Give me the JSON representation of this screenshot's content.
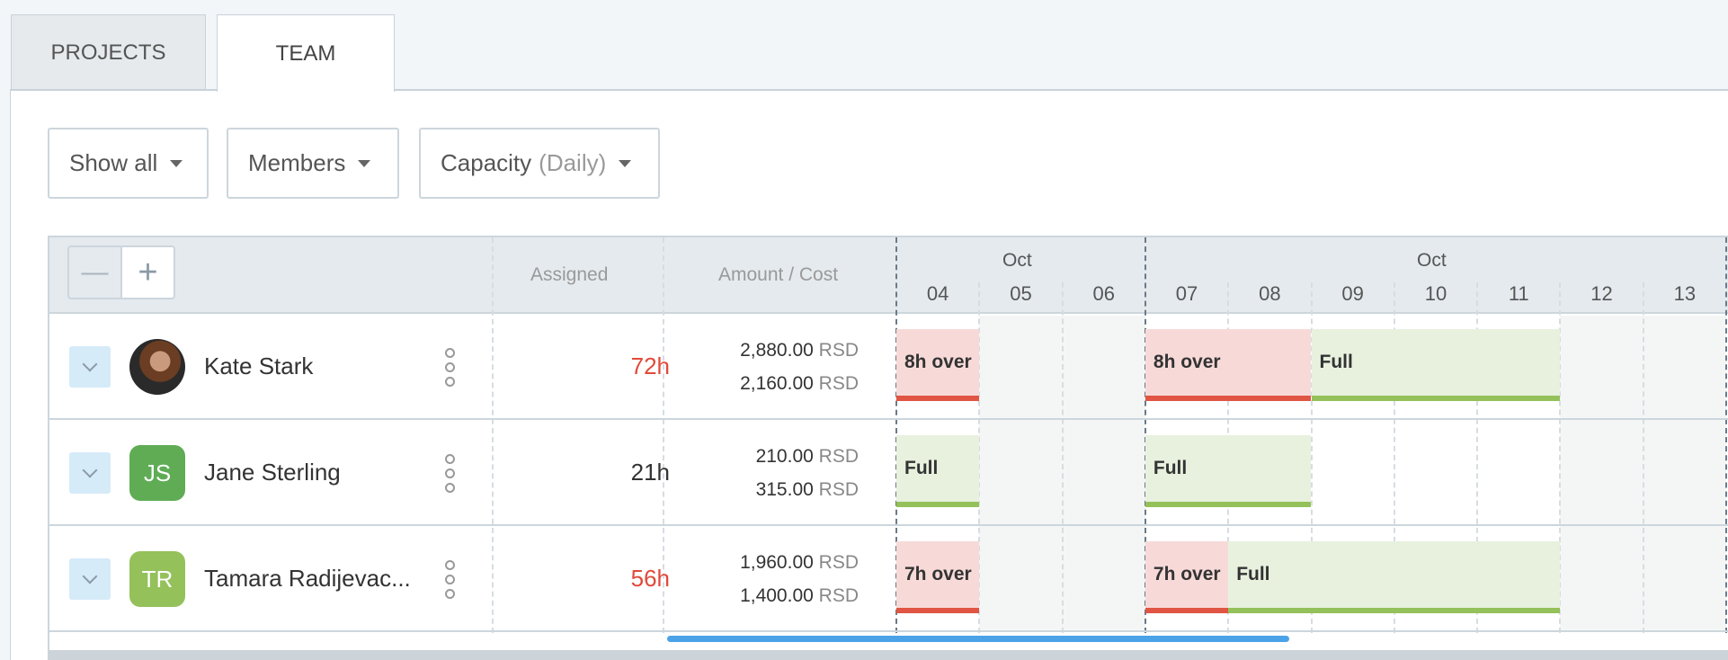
{
  "tabs": [
    {
      "label": "PROJECTS",
      "active": false
    },
    {
      "label": "TEAM",
      "active": true
    }
  ],
  "filters": {
    "show": "Show all",
    "group": "Members",
    "view": "Capacity",
    "view_mode": "(Daily)"
  },
  "table": {
    "zoom_out": "—",
    "zoom_in": "+",
    "headers": {
      "assigned": "Assigned",
      "amount": "Amount / Cost"
    },
    "months": [
      {
        "label": "Oct"
      },
      {
        "label": "Oct"
      }
    ],
    "days": [
      "04",
      "05",
      "06",
      "07",
      "08",
      "09",
      "10",
      "11",
      "12",
      "13"
    ],
    "weekend_days": [
      "05",
      "06",
      "12",
      "13"
    ],
    "colors": {
      "over": "#e05543",
      "full": "#94c15a",
      "over_bg": "#f7dad8",
      "full_bg": "#e8f1de"
    },
    "members": [
      {
        "name": "Kate Stark",
        "initials": "",
        "avatar": "photo",
        "assigned": "72h",
        "assigned_over": true,
        "amount": "2,880.00",
        "cost": "2,160.00",
        "currency": "RSD",
        "segments": [
          {
            "start": "04",
            "days": 1,
            "type": "over",
            "label": "8h over"
          },
          {
            "start": "07",
            "days": 2,
            "type": "over",
            "label": "8h over"
          },
          {
            "start": "09",
            "days": 3,
            "type": "full",
            "label": "Full"
          }
        ]
      },
      {
        "name": "Jane Sterling",
        "initials": "JS",
        "avatar_color": "#5fac55",
        "assigned": "21h",
        "assigned_over": false,
        "amount": "210.00",
        "cost": "315.00",
        "currency": "RSD",
        "segments": [
          {
            "start": "04",
            "days": 1,
            "type": "full",
            "label": "Full"
          },
          {
            "start": "07",
            "days": 2,
            "type": "full",
            "label": "Full"
          }
        ]
      },
      {
        "name": "Tamara Radijevac...",
        "initials": "TR",
        "avatar_color": "#94c15a",
        "assigned": "56h",
        "assigned_over": true,
        "amount": "1,960.00",
        "cost": "1,400.00",
        "currency": "RSD",
        "segments": [
          {
            "start": "04",
            "days": 1,
            "type": "over",
            "label": "7h over"
          },
          {
            "start": "07",
            "days": 1,
            "type": "over",
            "label": "7h over"
          },
          {
            "start": "08",
            "days": 4,
            "type": "full",
            "label": "Full"
          }
        ]
      }
    ]
  }
}
